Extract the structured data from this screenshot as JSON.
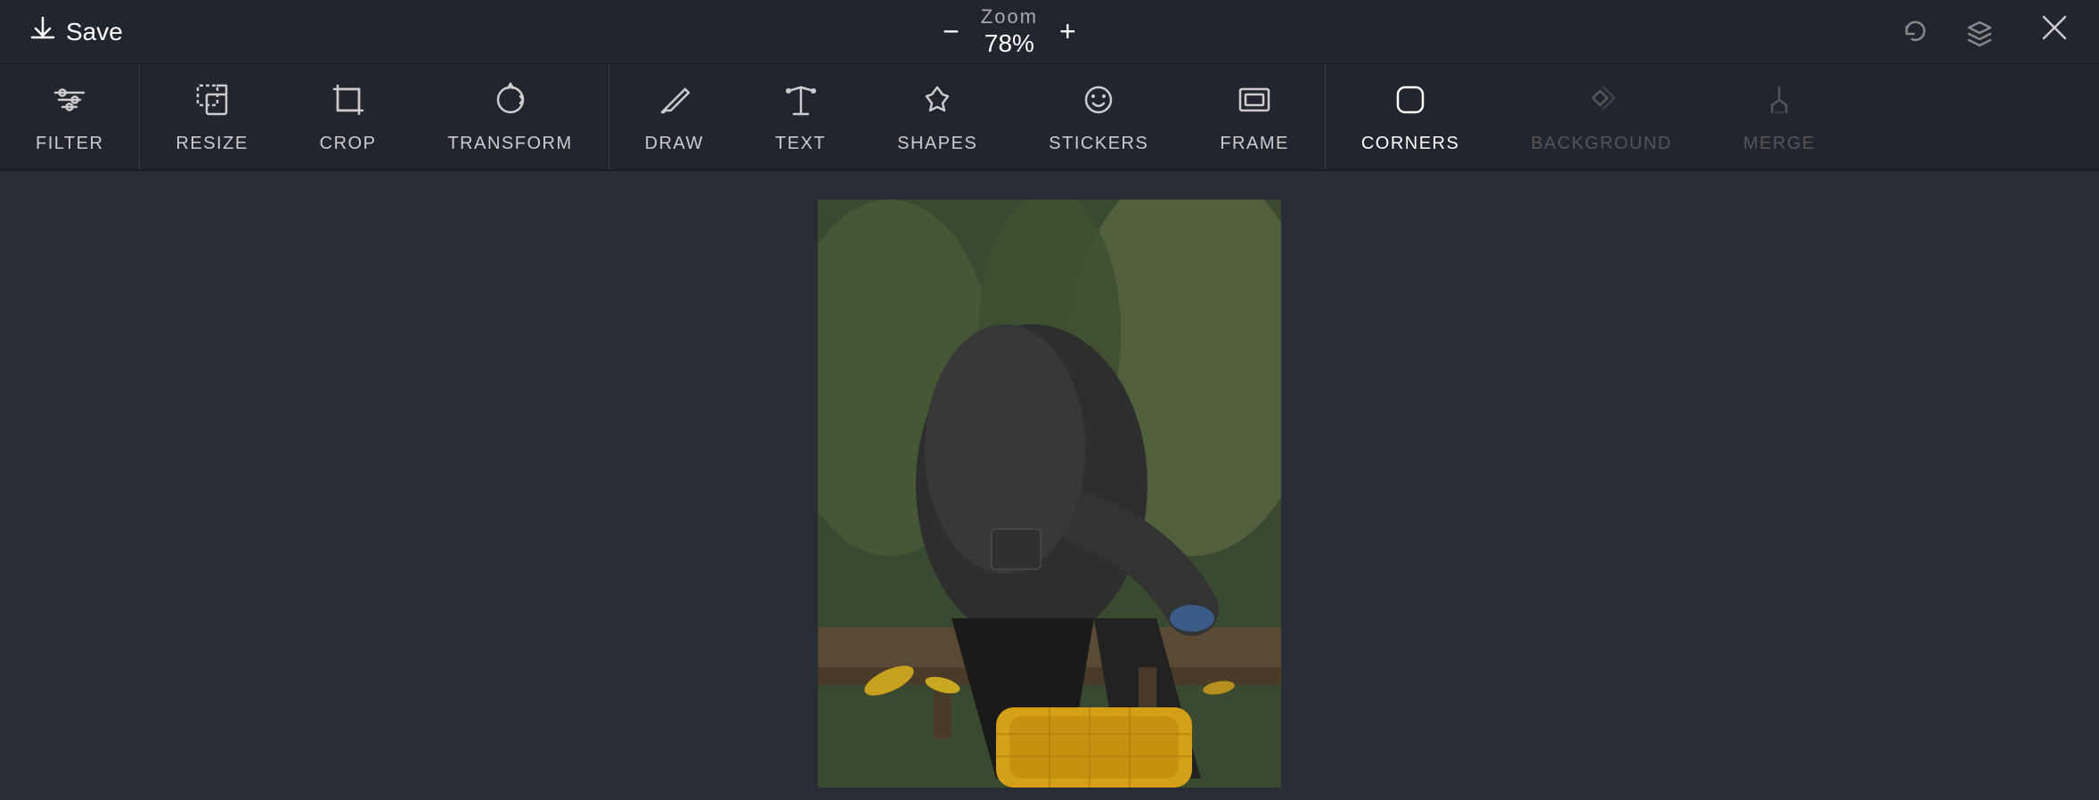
{
  "topbar": {
    "save_label": "Save",
    "zoom_label": "Zoom",
    "zoom_value": "78%",
    "zoom_minus": "−",
    "zoom_plus": "+"
  },
  "toolbar": {
    "groups": [
      {
        "id": "basic",
        "items": [
          {
            "id": "filter",
            "label": "FILTER",
            "icon": "filter",
            "active": false,
            "disabled": false
          }
        ]
      },
      {
        "id": "edit",
        "items": [
          {
            "id": "resize",
            "label": "RESIZE",
            "icon": "resize",
            "active": false,
            "disabled": false
          },
          {
            "id": "crop",
            "label": "CROP",
            "icon": "crop",
            "active": false,
            "disabled": false
          },
          {
            "id": "transform",
            "label": "TRANSFORM",
            "icon": "transform",
            "active": false,
            "disabled": false
          }
        ]
      },
      {
        "id": "create",
        "items": [
          {
            "id": "draw",
            "label": "DRAW",
            "icon": "draw",
            "active": false,
            "disabled": false
          },
          {
            "id": "text",
            "label": "TEXT",
            "icon": "text",
            "active": false,
            "disabled": false
          },
          {
            "id": "shapes",
            "label": "SHAPES",
            "icon": "shapes",
            "active": false,
            "disabled": false
          },
          {
            "id": "stickers",
            "label": "STICKERS",
            "icon": "stickers",
            "active": false,
            "disabled": false
          },
          {
            "id": "frame",
            "label": "FRAME",
            "icon": "frame",
            "active": false,
            "disabled": false
          }
        ]
      },
      {
        "id": "advanced",
        "items": [
          {
            "id": "corners",
            "label": "CORNERS",
            "icon": "corners",
            "active": true,
            "disabled": false
          },
          {
            "id": "background",
            "label": "BACKGROUND",
            "icon": "background",
            "active": false,
            "disabled": true
          },
          {
            "id": "merge",
            "label": "MERGE",
            "icon": "merge",
            "active": false,
            "disabled": true
          }
        ]
      }
    ]
  }
}
